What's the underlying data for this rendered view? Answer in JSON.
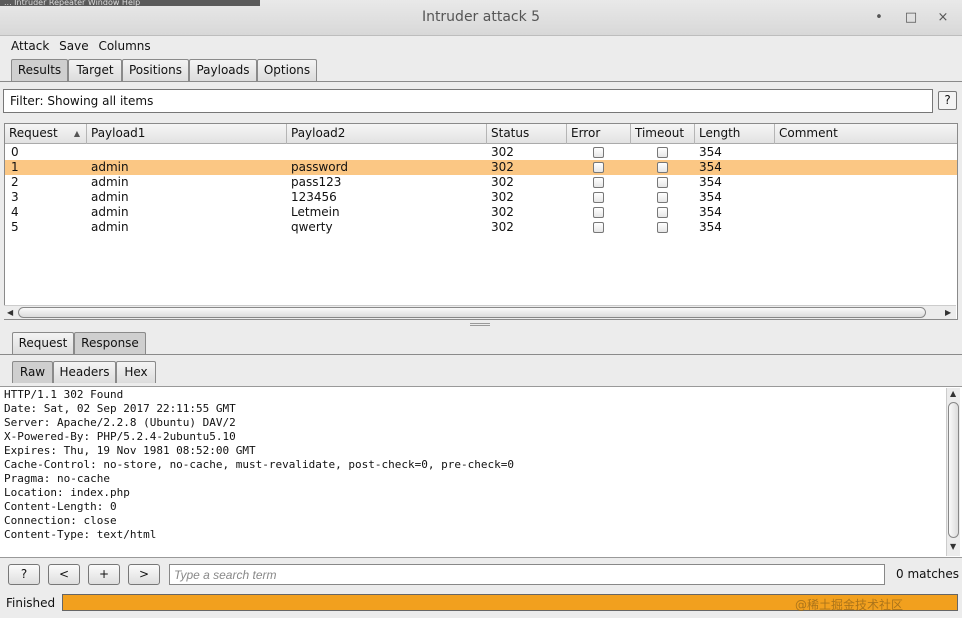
{
  "window": {
    "background_menu": "...   Intruder   Repeater   Window   Help",
    "title": "Intruder attack 5",
    "minimize_glyph": "•",
    "maximize_glyph": "□",
    "close_glyph": "×"
  },
  "menubar": {
    "items": [
      "Attack",
      "Save",
      "Columns"
    ]
  },
  "main_tabs": [
    "Results",
    "Target",
    "Positions",
    "Payloads",
    "Options"
  ],
  "filter": {
    "text": "Filter: Showing all items",
    "help_label": "?"
  },
  "table": {
    "columns": [
      "Request",
      "Payload1",
      "Payload2",
      "Status",
      "Error",
      "Timeout",
      "Length",
      "Comment"
    ],
    "sort_glyph": "▲",
    "selected_row_color": "#fbc784",
    "rows": [
      {
        "request": "0",
        "payload1": "",
        "payload2": "",
        "status": "302",
        "error": false,
        "timeout": false,
        "length": "354",
        "comment": "",
        "selected": false
      },
      {
        "request": "1",
        "payload1": "admin",
        "payload2": "password",
        "status": "302",
        "error": false,
        "timeout": false,
        "length": "354",
        "comment": "",
        "selected": true
      },
      {
        "request": "2",
        "payload1": "admin",
        "payload2": "pass123",
        "status": "302",
        "error": false,
        "timeout": false,
        "length": "354",
        "comment": "",
        "selected": false
      },
      {
        "request": "3",
        "payload1": "admin",
        "payload2": "123456",
        "status": "302",
        "error": false,
        "timeout": false,
        "length": "354",
        "comment": "",
        "selected": false
      },
      {
        "request": "4",
        "payload1": "admin",
        "payload2": "Letmein",
        "status": "302",
        "error": false,
        "timeout": false,
        "length": "354",
        "comment": "",
        "selected": false
      },
      {
        "request": "5",
        "payload1": "admin",
        "payload2": "qwerty",
        "status": "302",
        "error": false,
        "timeout": false,
        "length": "354",
        "comment": "",
        "selected": false
      }
    ]
  },
  "scroll_glyphs": {
    "left": "◀",
    "right": "▶",
    "up": "▲",
    "down": "▼"
  },
  "detail_tabs": [
    "Request",
    "Response"
  ],
  "view_tabs": [
    "Raw",
    "Headers",
    "Hex"
  ],
  "response_lines": [
    "HTTP/1.1 302 Found",
    "Date: Sat, 02 Sep 2017 22:11:55 GMT",
    "Server: Apache/2.2.8 (Ubuntu) DAV/2",
    "X-Powered-By: PHP/5.2.4-2ubuntu5.10",
    "Expires: Thu, 19 Nov 1981 08:52:00 GMT",
    "Cache-Control: no-store, no-cache, must-revalidate, post-check=0, pre-check=0",
    "Pragma: no-cache",
    "Location: index.php",
    "Content-Length: 0",
    "Connection: close",
    "Content-Type: text/html"
  ],
  "search": {
    "help_label": "?",
    "prev_label": "<",
    "add_label": "+",
    "next_label": ">",
    "placeholder": "Type a search term",
    "matches": "0 matches"
  },
  "status": {
    "label": "Finished",
    "progress": 1.0,
    "progress_color": "#f2a01e",
    "watermark": "@稀土掘金技术社区"
  }
}
